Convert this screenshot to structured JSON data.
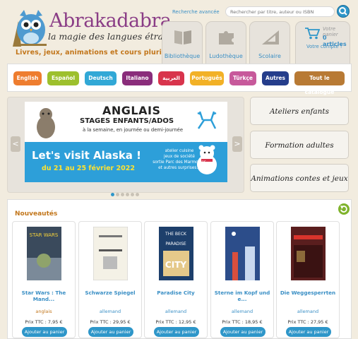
{
  "header": {
    "brand": "Abrakadabra",
    "tagline": "la magie des langues étrangères",
    "subline": "Livres, jeux, animations et cours plurilingues",
    "advanced_search": "Recherche avancée",
    "search_placeholder": "Rechercher par titre, auteur ou ISBN",
    "tabs": [
      {
        "label": "Bibliothèque",
        "icon": "book-icon"
      },
      {
        "label": "Ludothèque",
        "icon": "puzzle-icon"
      },
      {
        "label": "Scolaire",
        "icon": "ruler-icon"
      }
    ],
    "cart": {
      "title": "Votre panier",
      "count": "0 articles",
      "account": "Votre compte !"
    }
  },
  "languages": [
    {
      "label": "English",
      "color": "#ee7d2f"
    },
    {
      "label": "Español",
      "color": "#9dc02d"
    },
    {
      "label": "Deutsch",
      "color": "#31a8d6"
    },
    {
      "label": "Italiano",
      "color": "#8a2d7b"
    },
    {
      "label": "العربية",
      "color": "#d8344c"
    },
    {
      "label": "Português",
      "color": "#f2b126"
    },
    {
      "label": "Türkçe",
      "color": "#c7599b"
    },
    {
      "label": "Autres",
      "color": "#253d8b"
    },
    {
      "label": "Tout le catalogue",
      "color": "#b87a34"
    }
  ],
  "slider": {
    "heading": "ANGLAIS",
    "subheading": "STAGES ENFANTS/ADOS",
    "schedule": "à la semaine, en journée ou demi-journée",
    "promo": "Let's visit Alaska !",
    "dates": "du 21 au 25 février 2022",
    "activities": [
      "atelier cuisine",
      "jeux de société",
      "sortie Parc des Marmottes",
      "et autres surprises..."
    ],
    "prev": "<",
    "next": ">",
    "slide_count": 6,
    "active_slide": 1
  },
  "side_links": [
    "Ateliers enfants",
    "Formation adultes",
    "Animations contes et jeux"
  ],
  "news": {
    "title": "Nouveautés",
    "books": [
      {
        "title": "Star Wars : The Mand...",
        "lang": "anglais",
        "lang_color": "orange",
        "price": "Prix TTC : 7,95 €",
        "button": "Ajouter au panier",
        "cover": "#3a4a5c"
      },
      {
        "title": "Schwarze Spiegel",
        "lang": "allemand",
        "lang_color": "blue",
        "price": "Prix TTC : 29,95 €",
        "button": "Ajouter au panier",
        "cover": "#f4f1e6"
      },
      {
        "title": "Paradise City",
        "lang": "allemand",
        "lang_color": "blue",
        "price": "Prix TTC : 12,95 €",
        "button": "Ajouter au panier",
        "cover": "#1d3f6b"
      },
      {
        "title": "Sterne im Kopf und e...",
        "lang": "allemand",
        "lang_color": "blue",
        "price": "Prix TTC : 18,95 €",
        "button": "Ajouter au panier",
        "cover": "#2c4d8a"
      },
      {
        "title": "Die Weggesperrten",
        "lang": "allemand",
        "lang_color": "blue",
        "price": "Prix TTC : 27,95 €",
        "button": "Ajouter au panier",
        "cover": "#5a1e1e"
      }
    ]
  }
}
